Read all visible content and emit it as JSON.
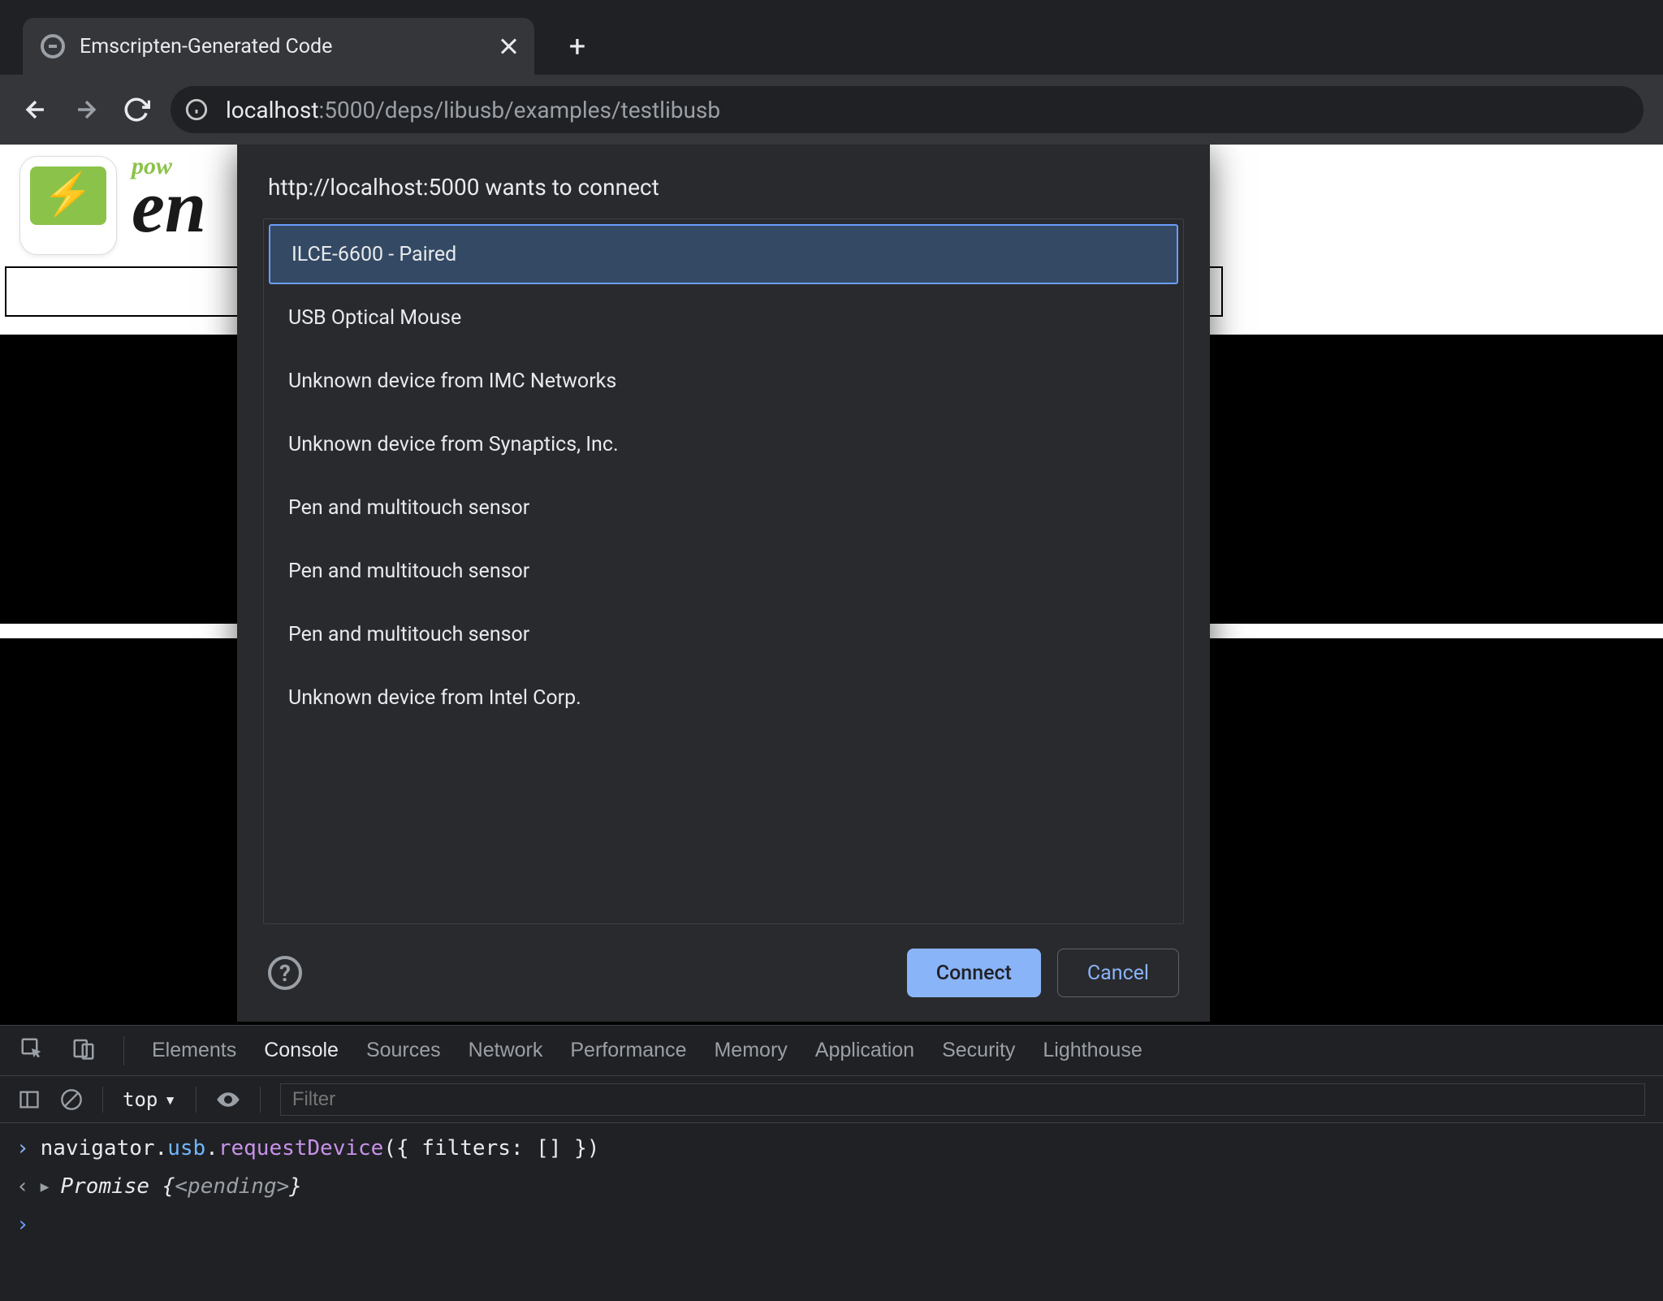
{
  "browser": {
    "tab_title": "Emscripten-Generated Code",
    "url_host": "localhost",
    "url_port_path": ":5000/deps/libusb/examples/testlibusb"
  },
  "page": {
    "pow": "pow",
    "en": "en"
  },
  "dialog": {
    "title": "http://localhost:5000 wants to connect",
    "devices": [
      "ILCE-6600 - Paired",
      "USB Optical Mouse",
      "Unknown device from IMC Networks",
      "Unknown device from Synaptics, Inc.",
      "Pen and multitouch sensor",
      "Pen and multitouch sensor",
      "Pen and multitouch sensor",
      "Unknown device from Intel Corp."
    ],
    "connect": "Connect",
    "cancel": "Cancel"
  },
  "devtools": {
    "tabs": [
      "Elements",
      "Console",
      "Sources",
      "Network",
      "Performance",
      "Memory",
      "Application",
      "Security",
      "Lighthouse"
    ],
    "active_tab": "Console",
    "context": "top",
    "filter_placeholder": "Filter",
    "console_input": "navigator.usb.requestDevice({ filters: [] })",
    "console_output_prefix": "Promise ",
    "console_output_state": "<pending>"
  }
}
